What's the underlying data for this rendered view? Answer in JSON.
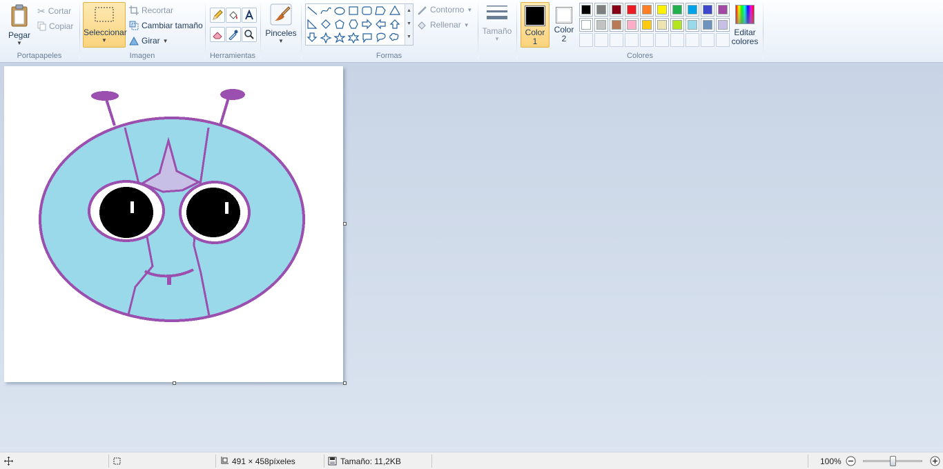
{
  "ribbon": {
    "clipboard": {
      "paste_label": "Pegar",
      "cut_label": "Cortar",
      "copy_label": "Copiar",
      "group_label": "Portapapeles"
    },
    "image": {
      "select_label": "Seleccionar",
      "crop_label": "Recortar",
      "resize_label": "Cambiar tamaño",
      "rotate_label": "Girar",
      "group_label": "Imagen"
    },
    "tools": {
      "group_label": "Herramientas"
    },
    "brushes": {
      "label": "Pinceles"
    },
    "shapes": {
      "outline_label": "Contorno",
      "fill_label": "Rellenar",
      "group_label": "Formas"
    },
    "size": {
      "label": "Tamaño"
    },
    "colors": {
      "color1_label": "Color",
      "color1_num": "1",
      "color2_label": "Color",
      "color2_num": "2",
      "color1_value": "#000000",
      "color2_value": "#ffffff",
      "edit_label": "Editar",
      "edit_label2": "colores",
      "group_label": "Colores",
      "palette_row1": [
        "#000000",
        "#7f7f7f",
        "#880015",
        "#ed1c24",
        "#ff7f27",
        "#fff200",
        "#22b14c",
        "#00a2e8",
        "#3f48cc",
        "#a349a4"
      ],
      "palette_row2": [
        "#ffffff",
        "#c3c3c3",
        "#b97a57",
        "#ffaec9",
        "#ffc90e",
        "#efe4b0",
        "#b5e61d",
        "#99d9ea",
        "#7092be",
        "#c8bfe7"
      ]
    }
  },
  "status": {
    "dimensions": "491 × 458píxeles",
    "file_size": "Tamaño: 11,2KB",
    "zoom": "100%"
  }
}
